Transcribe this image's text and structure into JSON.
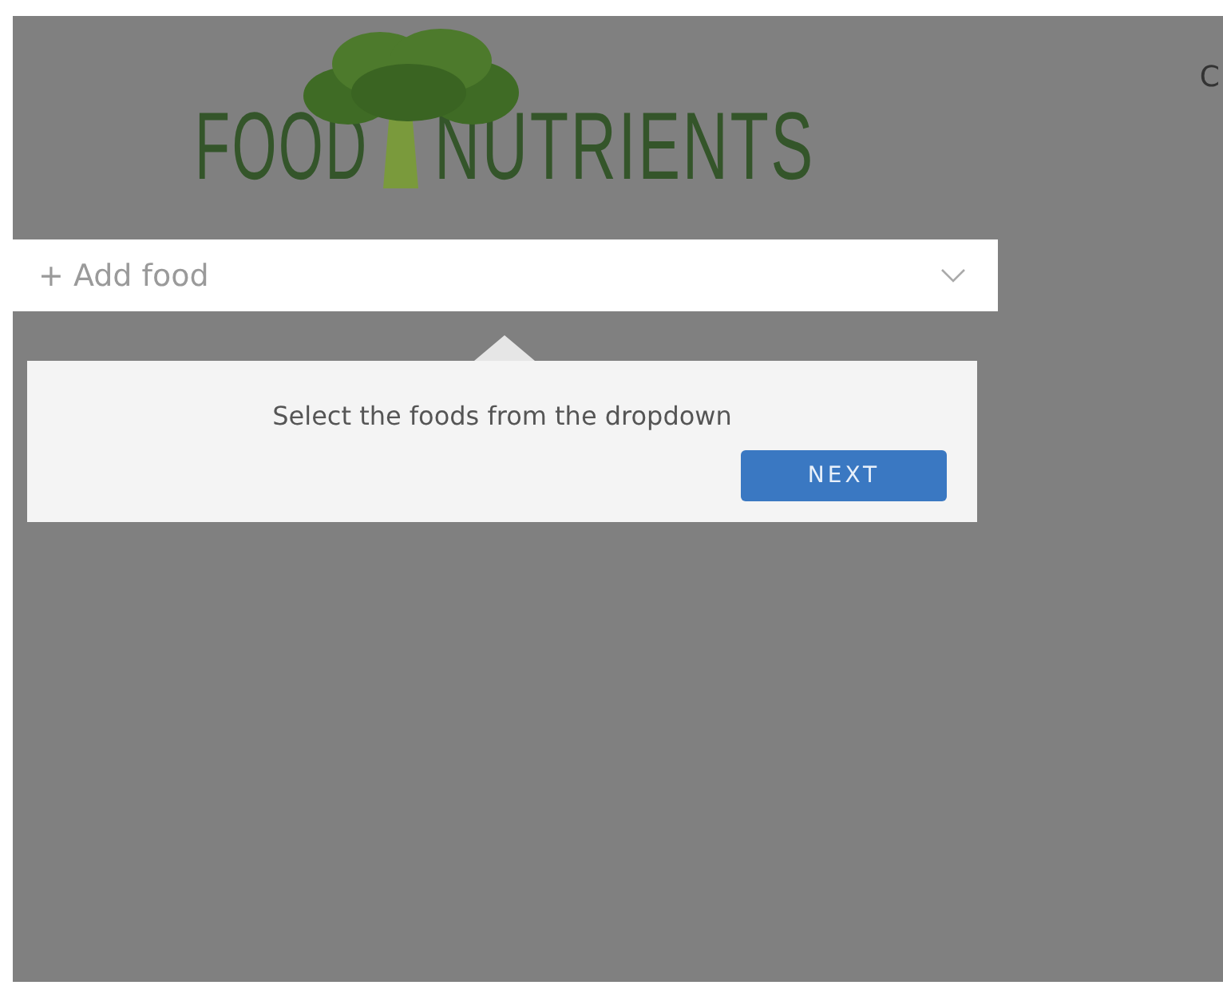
{
  "logo": {
    "left": "FOOD",
    "right": "NUTRIENTS"
  },
  "corner_text": "C",
  "food_select": {
    "placeholder": "+ Add food"
  },
  "tour_popup": {
    "message": "Select the foods from the dropdown",
    "button": "NEXT"
  }
}
